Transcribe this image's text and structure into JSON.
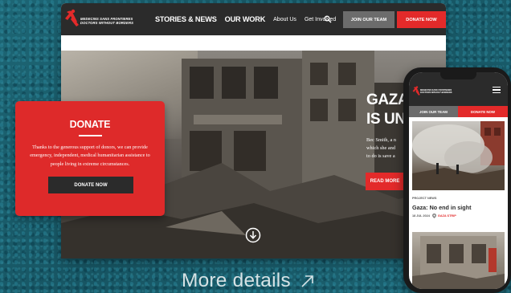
{
  "desktop": {
    "logo": {
      "line1": "MEDECINS SANS FRONTIERES",
      "line2": "DOCTORS WITHOUT BORDERS"
    },
    "nav": {
      "primary": [
        "STORIES & NEWS",
        "OUR WORK"
      ],
      "secondary": [
        "About Us",
        "Get Involved"
      ],
      "join_label": "JOIN OUR TEAM",
      "donate_label": "DONATE NOW"
    },
    "hero": {
      "title_line1": "GAZA:",
      "title_line2": "IS UNB",
      "body_lines": [
        "Bec Smith, a n",
        "which she and",
        "to do is save a"
      ],
      "read_more_label": "READ MORE"
    }
  },
  "donate_card": {
    "title": "DONATE",
    "body": "Thanks to the generous support of donors, we can provide emergency, independent, medical humanitarian assistance to people living in extreme circumstances.",
    "button_label": "DONATE NOW"
  },
  "phone": {
    "join_label": "JOIN OUR TEAM",
    "donate_label": "DONATE NOW",
    "tag": "PROJECT NEWS",
    "headline": "Gaza: No end in sight",
    "date": "18 JUL 2024",
    "location": "GAZA STRIP"
  },
  "more_details": "More details",
  "colors": {
    "brand_red": "#e32a2a",
    "nav_dark": "#2b2b2b",
    "join_grey": "#6c6c6c",
    "teal_bg": "#1b5f6e"
  },
  "icons": [
    "msf-logo-icon",
    "search-icon",
    "scroll-down-icon",
    "hamburger-menu-icon",
    "location-pin-icon",
    "external-arrow-icon"
  ]
}
